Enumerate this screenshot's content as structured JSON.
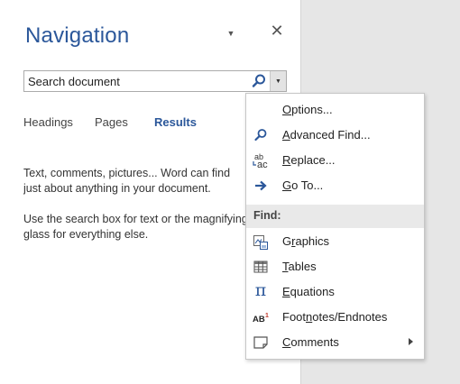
{
  "pane": {
    "title": "Navigation",
    "search": {
      "placeholder": "Search document"
    },
    "tabs": [
      {
        "label": "Headings"
      },
      {
        "label": "Pages"
      },
      {
        "label": "Results"
      }
    ],
    "description": {
      "line1": "Text, comments, pictures... Word can find",
      "line2": "just about anything in your document.",
      "line3": "Use the search box for text or the magnifying",
      "line4": "glass for everything else."
    }
  },
  "menu": {
    "options": {
      "mn": "O",
      "rest": "ptions..."
    },
    "advanced_find": {
      "mn": "A",
      "rest": "dvanced Find..."
    },
    "replace": {
      "mn": "R",
      "rest": "eplace..."
    },
    "goto": {
      "mn": "G",
      "rest": "o To..."
    },
    "find_header": "Find:",
    "graphics": {
      "pre": "G",
      "mn": "r",
      "rest": "aphics"
    },
    "tables": {
      "mn": "T",
      "rest": "ables"
    },
    "equations": {
      "mn": "E",
      "rest": "quations"
    },
    "footnotes": {
      "pre": "Foot",
      "mn": "n",
      "rest": "otes/Endnotes"
    },
    "comments": {
      "mn": "C",
      "rest": "omments"
    }
  },
  "icons": {
    "accent": "#2b579a",
    "search": "magnifier-icon",
    "advanced_find": "magnifier-icon",
    "replace": "replace-abc-icon",
    "goto": "arrow-right-icon",
    "graphics": "graphics-icon",
    "tables": "table-icon",
    "equations": "pi-icon",
    "footnotes": "footnote-ab1-icon",
    "comments": "comment-icon"
  }
}
